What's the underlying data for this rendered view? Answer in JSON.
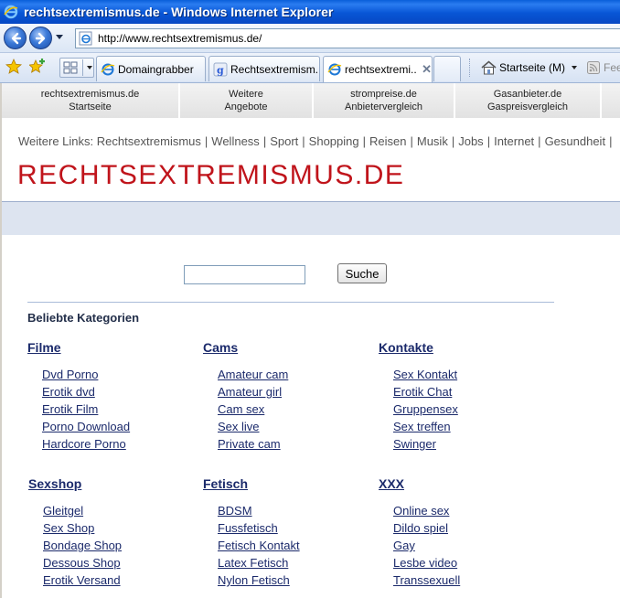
{
  "window": {
    "title": "rechtsextremismus.de - Windows Internet Explorer"
  },
  "address_bar": {
    "url": "http://www.rechtsextremismus.de/"
  },
  "tabs": [
    {
      "label": "Domaingrabber",
      "icon": "ie-page-icon",
      "active": false
    },
    {
      "label": "Rechtsextremism...",
      "icon": "google-icon",
      "active": false
    },
    {
      "label": "rechtsextremi...",
      "icon": "ie-page-icon",
      "active": true
    }
  ],
  "command_bar": {
    "home_label": "Startseite (M)",
    "feed_label": "Fee"
  },
  "top_nav": [
    {
      "line1": "rechtsextremismus.de",
      "line2": "Startseite"
    },
    {
      "line1": "Weitere",
      "line2": "Angebote"
    },
    {
      "line1": "strompreise.de",
      "line2": "Anbietervergleich"
    },
    {
      "line1": "Gasanbieter.de",
      "line2": "Gaspreisvergleich"
    }
  ],
  "weitere_links": {
    "prefix": "Weitere Links:",
    "items": [
      "Rechtsextremismus",
      "Wellness",
      "Sport",
      "Shopping",
      "Reisen",
      "Musik",
      "Jobs",
      "Internet",
      "Gesundheit"
    ]
  },
  "site_title": "RECHTSEXTREMISMUS.DE",
  "search": {
    "value": "",
    "button_label": "Suche"
  },
  "categories_heading": "Beliebte Kategorien",
  "categories": [
    {
      "title": "Filme",
      "links": [
        "Dvd Porno",
        "Erotik dvd",
        "Erotik Film",
        "Porno Download",
        "Hardcore Porno"
      ]
    },
    {
      "title": "Cams",
      "links": [
        "Amateur cam",
        "Amateur girl",
        "Cam sex",
        "Sex live",
        "Private cam"
      ]
    },
    {
      "title": "Kontakte",
      "links": [
        "Sex Kontakt",
        "Erotik Chat",
        "Gruppensex",
        "Sex treffen",
        "Swinger"
      ]
    },
    {
      "title": "Sexshop",
      "links": [
        "Gleitgel",
        "Sex Shop",
        "Bondage Shop",
        "Dessous Shop",
        "Erotik Versand"
      ]
    },
    {
      "title": "Fetisch",
      "links": [
        "BDSM",
        "Fussfetisch",
        "Fetisch Kontakt",
        "Latex Fetisch",
        "Nylon Fetisch"
      ]
    },
    {
      "title": "XXX",
      "links": [
        "Online sex",
        "Dildo spiel",
        "Gay",
        "Lesbe video",
        "Transsexuell"
      ]
    }
  ],
  "colors": {
    "title_red": "#c0141b",
    "link_blue": "#1b2a6b",
    "band_blue": "#dde4f0"
  }
}
